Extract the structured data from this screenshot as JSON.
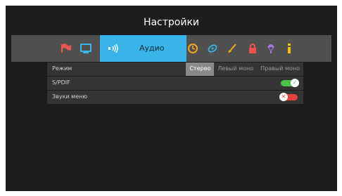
{
  "title": "Настройки",
  "menubar": {
    "icons": [
      "flag-icon",
      "display-icon",
      "audio-icon",
      "clock-icon",
      "satellite-icon",
      "brush-icon",
      "lock-icon",
      "balloon-icon",
      "info-icon"
    ],
    "active_label": "Аудио"
  },
  "colors": {
    "accent": "#38b4e8",
    "on": "#4cc24a",
    "off": "#e8413c",
    "icon_orange": "#f5a623",
    "icon_red": "#ef5350"
  },
  "settings": {
    "mode": {
      "label": "Режим",
      "options": [
        "Стерео",
        "Левый моно",
        "Правый моно"
      ],
      "selected": "Стерео"
    },
    "spdif": {
      "label": "S/PDIF",
      "state": "on"
    },
    "menu_sounds": {
      "label": "Звуки меню",
      "state": "off"
    }
  }
}
